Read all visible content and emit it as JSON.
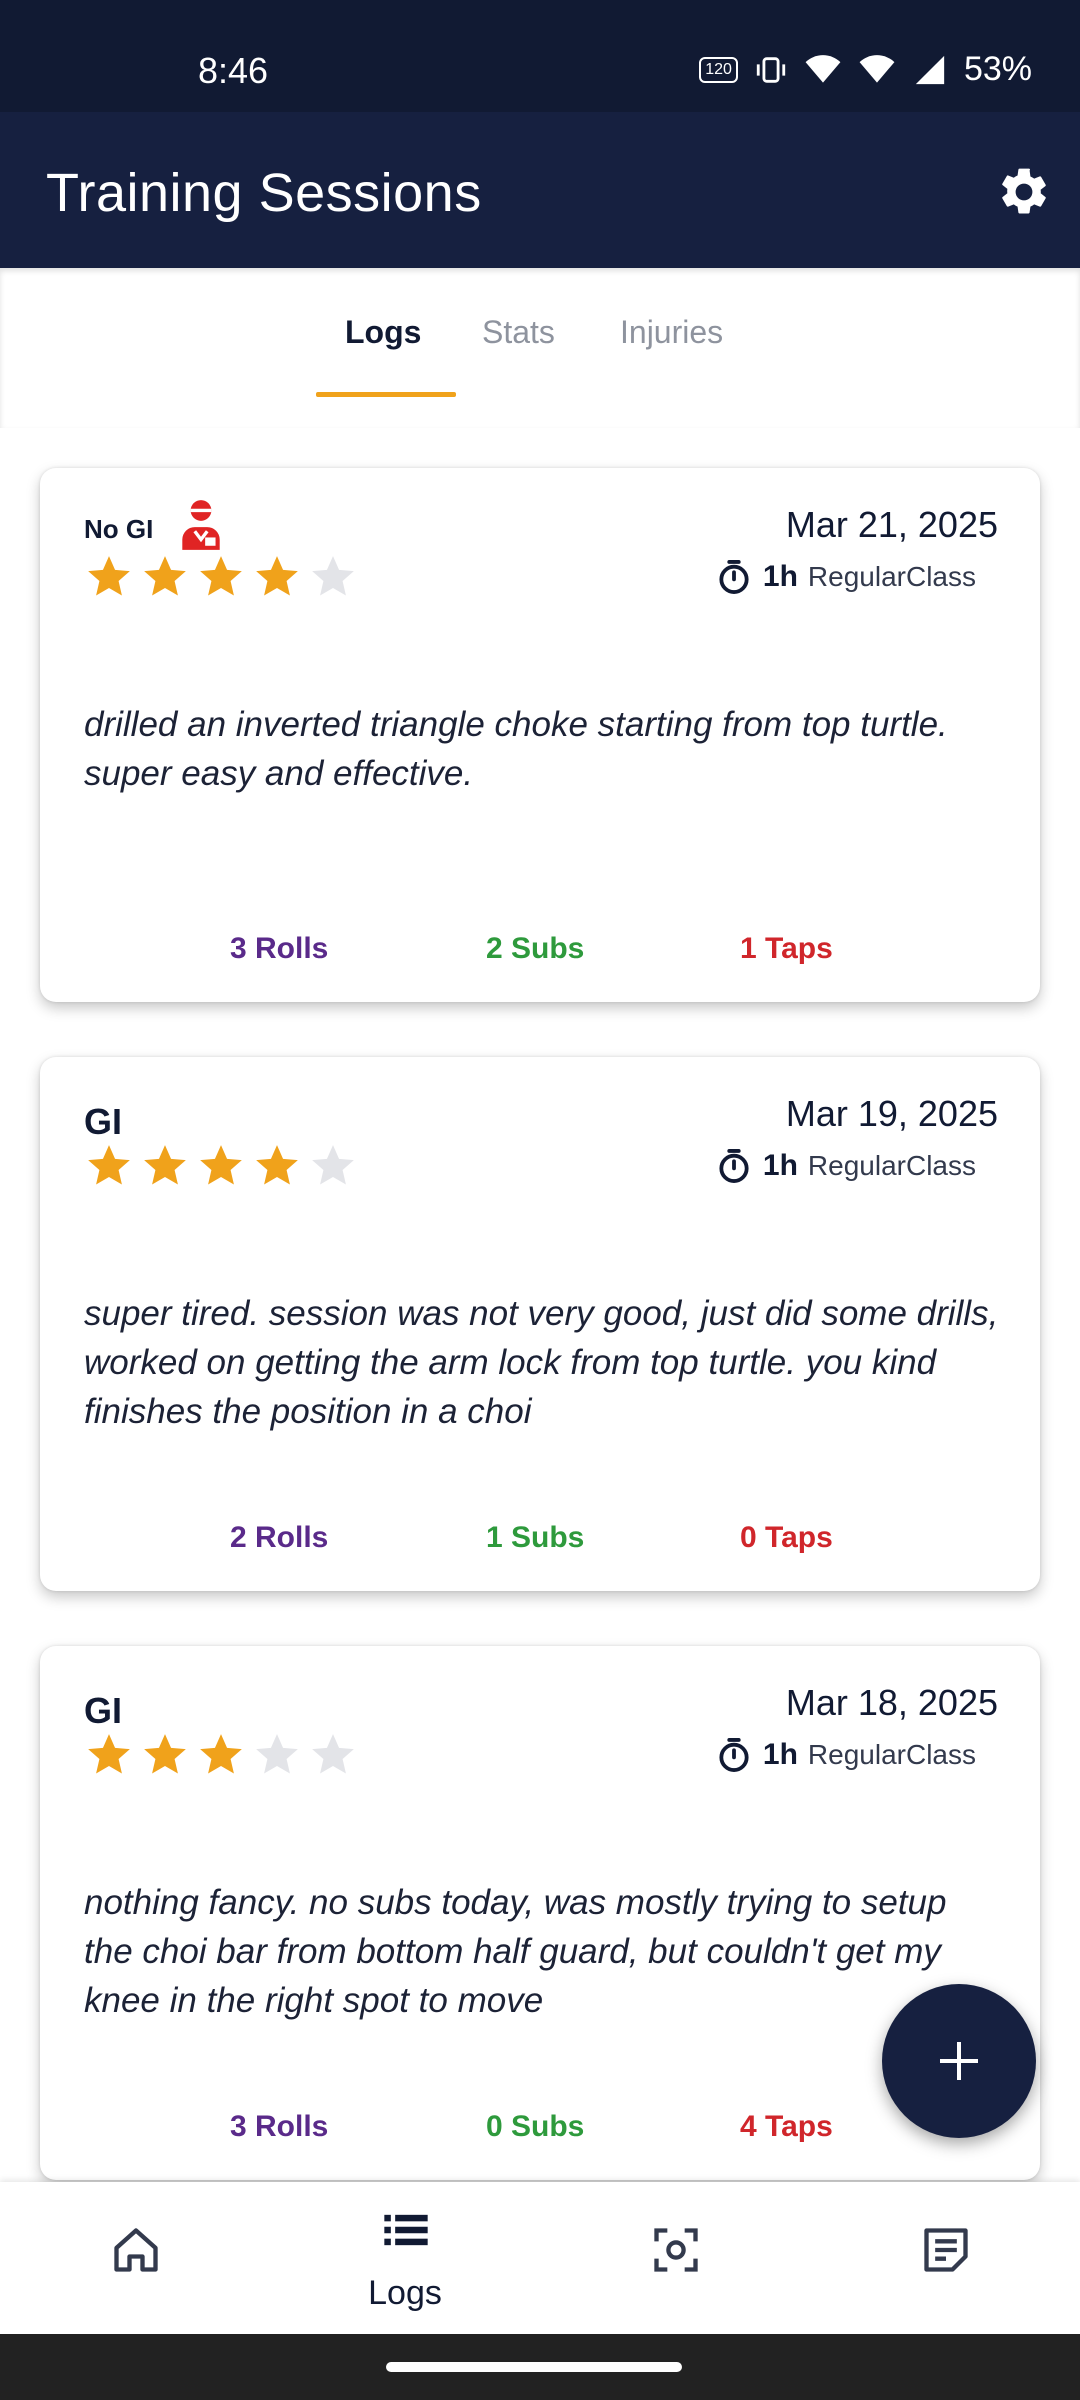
{
  "status": {
    "time": "8:46",
    "refresh_badge": "120",
    "battery": "53%"
  },
  "appbar": {
    "title": "Training Sessions",
    "settings_icon": "gear-icon"
  },
  "tabs": [
    {
      "label": "Logs",
      "active": true
    },
    {
      "label": "Stats",
      "active": false
    },
    {
      "label": "Injuries",
      "active": false
    }
  ],
  "colors": {
    "primary": "#162040",
    "accent": "#f0a21b",
    "rolls": "#5a2a8a",
    "subs": "#2e9a3c",
    "taps": "#d0262b",
    "injury": "#e02424"
  },
  "cards": [
    {
      "kind": "No GI",
      "injury_icon": "injured-person-icon",
      "rating": 4,
      "rating_max": 5,
      "date": "Mar 21, 2025",
      "duration": "1h",
      "class_type": "RegularClass",
      "notes": "drilled an inverted triangle choke starting from top turtle. super easy and effective.",
      "rolls": "3 Rolls",
      "subs": "2 Subs",
      "taps": "1 Taps"
    },
    {
      "kind": "GI",
      "rating": 4,
      "rating_max": 5,
      "date": "Mar 19, 2025",
      "duration": "1h",
      "class_type": "RegularClass",
      "notes": "super tired. session was not very good, just did some drills, worked on getting the arm lock from top turtle. you kind finishes the position in a choi",
      "rolls": "2 Rolls",
      "subs": "1 Subs",
      "taps": "0 Taps"
    },
    {
      "kind": "GI",
      "rating": 3,
      "rating_max": 5,
      "date": "Mar 18, 2025",
      "duration": "1h",
      "class_type": "RegularClass",
      "notes": "nothing fancy. no subs today, was mostly trying to setup the choi bar from bottom half guard, but couldn't get my knee in the right spot to move",
      "rolls": "3 Rolls",
      "subs": "0 Subs",
      "taps": "4 Taps"
    }
  ],
  "fab": {
    "icon": "plus-icon"
  },
  "bottom_nav": [
    {
      "icon": "home-icon",
      "label": ""
    },
    {
      "icon": "list-icon",
      "label": "Logs",
      "active": true
    },
    {
      "icon": "scan-icon",
      "label": ""
    },
    {
      "icon": "note-icon",
      "label": ""
    }
  ]
}
